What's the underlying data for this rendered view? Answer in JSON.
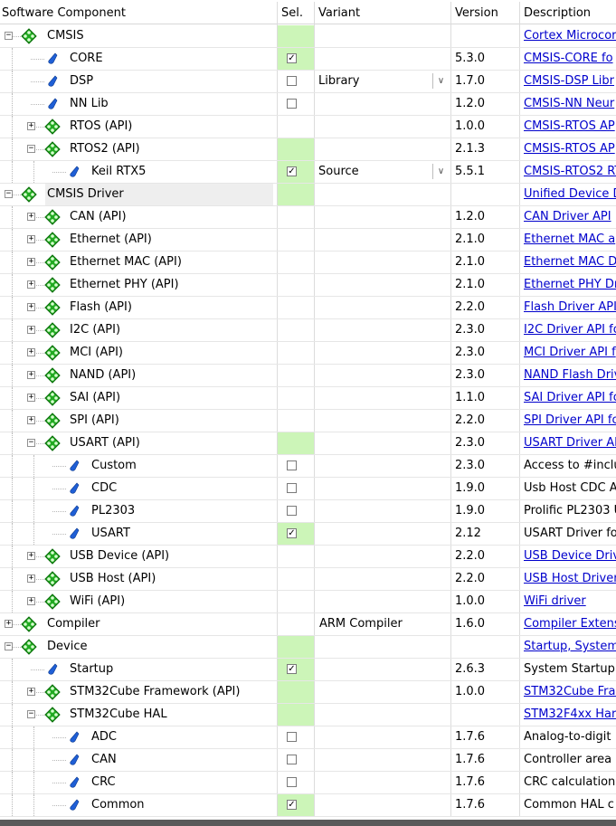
{
  "header": {
    "component": "Software Component",
    "sel": "Sel.",
    "variant": "Variant",
    "version": "Version",
    "description": "Description"
  },
  "colors": {
    "selection_green": "#ccf5b8",
    "link_blue": "#0000cc",
    "diamond_green": "#22aa22"
  },
  "rows": [
    {
      "label": "CMSIS",
      "level": 0,
      "exp": "minus",
      "icon": "green-diamond",
      "sel": "green",
      "variant": "",
      "dropdown": false,
      "version": "",
      "desc": "Cortex Microcor",
      "link": true,
      "highlight": false
    },
    {
      "label": "CORE",
      "level": 1,
      "exp": "none",
      "icon": "blue-dot",
      "sel": "checked",
      "variant": "",
      "dropdown": false,
      "version": "5.3.0",
      "desc": "CMSIS-CORE fo",
      "link": true,
      "highlight": false
    },
    {
      "label": "DSP",
      "level": 1,
      "exp": "none",
      "icon": "blue-dot",
      "sel": "unchecked",
      "variant": "Library",
      "dropdown": true,
      "version": "1.7.0",
      "desc": "CMSIS-DSP Libr",
      "link": true,
      "highlight": false
    },
    {
      "label": "NN Lib",
      "level": 1,
      "exp": "none",
      "icon": "blue-dot",
      "sel": "unchecked",
      "variant": "",
      "dropdown": false,
      "version": "1.2.0",
      "desc": "CMSIS-NN Neur",
      "link": true,
      "highlight": false
    },
    {
      "label": "RTOS (API)",
      "level": 1,
      "exp": "plus",
      "icon": "green-diamond",
      "sel": "none",
      "variant": "",
      "dropdown": false,
      "version": "1.0.0",
      "desc": "CMSIS-RTOS AP",
      "link": true,
      "highlight": false
    },
    {
      "label": "RTOS2 (API)",
      "level": 1,
      "exp": "minus",
      "icon": "green-diamond",
      "sel": "green",
      "variant": "",
      "dropdown": false,
      "version": "2.1.3",
      "desc": "CMSIS-RTOS AP",
      "link": true,
      "highlight": false
    },
    {
      "label": "Keil RTX5",
      "level": 2,
      "exp": "none",
      "icon": "blue-dot",
      "sel": "checked",
      "variant": "Source",
      "dropdown": true,
      "version": "5.5.1",
      "desc": "CMSIS-RTOS2 RT",
      "link": true,
      "highlight": false
    },
    {
      "label": "CMSIS Driver",
      "level": 0,
      "exp": "minus",
      "icon": "green-diamond",
      "sel": "green",
      "variant": "",
      "dropdown": false,
      "version": "",
      "desc": "Unified Device D",
      "link": true,
      "highlight": true
    },
    {
      "label": "CAN (API)",
      "level": 1,
      "exp": "plus",
      "icon": "green-diamond",
      "sel": "none",
      "variant": "",
      "dropdown": false,
      "version": "1.2.0",
      "desc": "CAN Driver API",
      "link": true,
      "highlight": false
    },
    {
      "label": "Ethernet (API)",
      "level": 1,
      "exp": "plus",
      "icon": "green-diamond",
      "sel": "none",
      "variant": "",
      "dropdown": false,
      "version": "2.1.0",
      "desc": "Ethernet MAC a",
      "link": true,
      "highlight": false
    },
    {
      "label": "Ethernet MAC (API)",
      "level": 1,
      "exp": "plus",
      "icon": "green-diamond",
      "sel": "none",
      "variant": "",
      "dropdown": false,
      "version": "2.1.0",
      "desc": "Ethernet MAC D",
      "link": true,
      "highlight": false
    },
    {
      "label": "Ethernet PHY (API)",
      "level": 1,
      "exp": "plus",
      "icon": "green-diamond",
      "sel": "none",
      "variant": "",
      "dropdown": false,
      "version": "2.1.0",
      "desc": "Ethernet PHY Dr",
      "link": true,
      "highlight": false
    },
    {
      "label": "Flash (API)",
      "level": 1,
      "exp": "plus",
      "icon": "green-diamond",
      "sel": "none",
      "variant": "",
      "dropdown": false,
      "version": "2.2.0",
      "desc": "Flash Driver API",
      "link": true,
      "highlight": false
    },
    {
      "label": "I2C (API)",
      "level": 1,
      "exp": "plus",
      "icon": "green-diamond",
      "sel": "none",
      "variant": "",
      "dropdown": false,
      "version": "2.3.0",
      "desc": "I2C Driver API fo",
      "link": true,
      "highlight": false
    },
    {
      "label": "MCI (API)",
      "level": 1,
      "exp": "plus",
      "icon": "green-diamond",
      "sel": "none",
      "variant": "",
      "dropdown": false,
      "version": "2.3.0",
      "desc": "MCI Driver API f",
      "link": true,
      "highlight": false
    },
    {
      "label": "NAND (API)",
      "level": 1,
      "exp": "plus",
      "icon": "green-diamond",
      "sel": "none",
      "variant": "",
      "dropdown": false,
      "version": "2.3.0",
      "desc": "NAND Flash Driv",
      "link": true,
      "highlight": false
    },
    {
      "label": "SAI (API)",
      "level": 1,
      "exp": "plus",
      "icon": "green-diamond",
      "sel": "none",
      "variant": "",
      "dropdown": false,
      "version": "1.1.0",
      "desc": "SAI Driver API fo",
      "link": true,
      "highlight": false
    },
    {
      "label": "SPI (API)",
      "level": 1,
      "exp": "plus",
      "icon": "green-diamond",
      "sel": "none",
      "variant": "",
      "dropdown": false,
      "version": "2.2.0",
      "desc": "SPI Driver API fo",
      "link": true,
      "highlight": false
    },
    {
      "label": "USART (API)",
      "level": 1,
      "exp": "minus",
      "icon": "green-diamond",
      "sel": "green",
      "variant": "",
      "dropdown": false,
      "version": "2.3.0",
      "desc": "USART Driver AP",
      "link": true,
      "highlight": false
    },
    {
      "label": "Custom",
      "level": 2,
      "exp": "none",
      "icon": "blue-dot",
      "sel": "unchecked",
      "variant": "",
      "dropdown": false,
      "version": "2.3.0",
      "desc": "Access to #inclu",
      "link": false,
      "highlight": false
    },
    {
      "label": "CDC",
      "level": 2,
      "exp": "none",
      "icon": "blue-dot",
      "sel": "unchecked",
      "variant": "",
      "dropdown": false,
      "version": "1.9.0",
      "desc": "Usb Host CDC A",
      "link": false,
      "highlight": false
    },
    {
      "label": "PL2303",
      "level": 2,
      "exp": "none",
      "icon": "blue-dot",
      "sel": "unchecked",
      "variant": "",
      "dropdown": false,
      "version": "1.9.0",
      "desc": "Prolific PL2303 U",
      "link": false,
      "highlight": false
    },
    {
      "label": "USART",
      "level": 2,
      "exp": "none",
      "icon": "blue-dot",
      "sel": "checked",
      "variant": "",
      "dropdown": false,
      "version": "2.12",
      "desc": "USART Driver for",
      "link": false,
      "highlight": false
    },
    {
      "label": "USB Device (API)",
      "level": 1,
      "exp": "plus",
      "icon": "green-diamond",
      "sel": "none",
      "variant": "",
      "dropdown": false,
      "version": "2.2.0",
      "desc": "USB Device Driv",
      "link": true,
      "highlight": false
    },
    {
      "label": "USB Host (API)",
      "level": 1,
      "exp": "plus",
      "icon": "green-diamond",
      "sel": "none",
      "variant": "",
      "dropdown": false,
      "version": "2.2.0",
      "desc": "USB Host Driver",
      "link": true,
      "highlight": false
    },
    {
      "label": "WiFi (API)",
      "level": 1,
      "exp": "plus",
      "icon": "green-diamond",
      "sel": "none",
      "variant": "",
      "dropdown": false,
      "version": "1.0.0",
      "desc": "WiFi driver",
      "link": true,
      "highlight": false
    },
    {
      "label": "Compiler",
      "level": 0,
      "exp": "plus",
      "icon": "green-diamond",
      "sel": "none",
      "variant": "ARM Compiler",
      "dropdown": false,
      "version": "1.6.0",
      "desc": "Compiler Extens",
      "link": true,
      "highlight": false
    },
    {
      "label": "Device",
      "level": 0,
      "exp": "minus",
      "icon": "green-diamond",
      "sel": "green",
      "variant": "",
      "dropdown": false,
      "version": "",
      "desc": "Startup, System",
      "link": true,
      "highlight": false
    },
    {
      "label": "Startup",
      "level": 1,
      "exp": "none",
      "icon": "blue-dot",
      "sel": "checked",
      "variant": "",
      "dropdown": false,
      "version": "2.6.3",
      "desc": "System Startup f",
      "link": false,
      "highlight": false
    },
    {
      "label": "STM32Cube Framework (API)",
      "level": 1,
      "exp": "plus",
      "icon": "green-diamond",
      "sel": "green",
      "variant": "",
      "dropdown": false,
      "version": "1.0.0",
      "desc": "STM32Cube Fran",
      "link": true,
      "highlight": false
    },
    {
      "label": "STM32Cube HAL",
      "level": 1,
      "exp": "minus",
      "icon": "green-diamond",
      "sel": "green",
      "variant": "",
      "dropdown": false,
      "version": "",
      "desc": "STM32F4xx Hard",
      "link": true,
      "highlight": false
    },
    {
      "label": "ADC",
      "level": 2,
      "exp": "none",
      "icon": "blue-dot",
      "sel": "unchecked",
      "variant": "",
      "dropdown": false,
      "version": "1.7.6",
      "desc": "Analog-to-digit",
      "link": false,
      "highlight": false
    },
    {
      "label": "CAN",
      "level": 2,
      "exp": "none",
      "icon": "blue-dot",
      "sel": "unchecked",
      "variant": "",
      "dropdown": false,
      "version": "1.7.6",
      "desc": "Controller area r",
      "link": false,
      "highlight": false
    },
    {
      "label": "CRC",
      "level": 2,
      "exp": "none",
      "icon": "blue-dot",
      "sel": "unchecked",
      "variant": "",
      "dropdown": false,
      "version": "1.7.6",
      "desc": "CRC calculation",
      "link": false,
      "highlight": false
    },
    {
      "label": "Common",
      "level": 2,
      "exp": "none",
      "icon": "blue-dot",
      "sel": "checked",
      "variant": "",
      "dropdown": false,
      "version": "1.7.6",
      "desc": "Common HAL c",
      "link": false,
      "highlight": false
    }
  ]
}
